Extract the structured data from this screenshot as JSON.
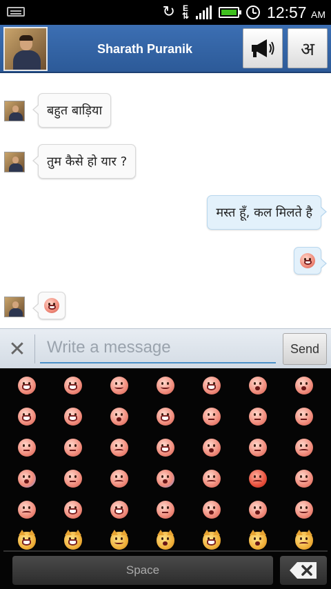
{
  "status_bar": {
    "data_indicator": "E",
    "time": "12:57",
    "ampm": "AM",
    "battery_color": "#3fbf1f",
    "icons": [
      "keyboard-icon",
      "sync-icon",
      "data-transfer-icon",
      "signal-icon",
      "battery-icon",
      "alarm-icon"
    ]
  },
  "header": {
    "contact_name": "Sharath Puranik",
    "speaker_icon": "megaphone-icon",
    "language_label": "अ",
    "background": "#2f5e9e"
  },
  "messages": [
    {
      "direction": "in",
      "text": "बहुत बाड़िया"
    },
    {
      "direction": "in",
      "text": "तुम कैसे हो यार ?"
    },
    {
      "direction": "out",
      "text": "मस्त हूँ, कल मिलते है"
    },
    {
      "direction": "out",
      "emoji": "grinning-face"
    },
    {
      "direction": "in",
      "emoji": "grinning-face"
    }
  ],
  "input": {
    "placeholder": "Write a message",
    "value": "",
    "send_label": "Send",
    "clear_icon": "close-icon"
  },
  "keyboard": {
    "emoji_rows": [
      [
        "grin",
        "grin",
        "smile",
        "smile",
        "grin",
        "kiss",
        "kiss"
      ],
      [
        "tongue",
        "tongue",
        "open",
        "grin",
        "flat",
        "sweat",
        "flat"
      ],
      [
        "flat",
        "flat",
        "sad",
        "tears",
        "sob",
        "sleep",
        "sad"
      ],
      [
        "fear",
        "sweat",
        "sad",
        "scream",
        "sad",
        "angry",
        "smile"
      ],
      [
        "sad",
        "grin",
        "tongue",
        "mask",
        "open",
        "dizzy",
        "smile"
      ],
      [
        "cat",
        "cat",
        "cat-heart",
        "cat-kiss",
        "cat",
        "cat-scream",
        "cat-cry"
      ]
    ],
    "space_label": "Space",
    "backspace_icon": "backspace-icon"
  }
}
